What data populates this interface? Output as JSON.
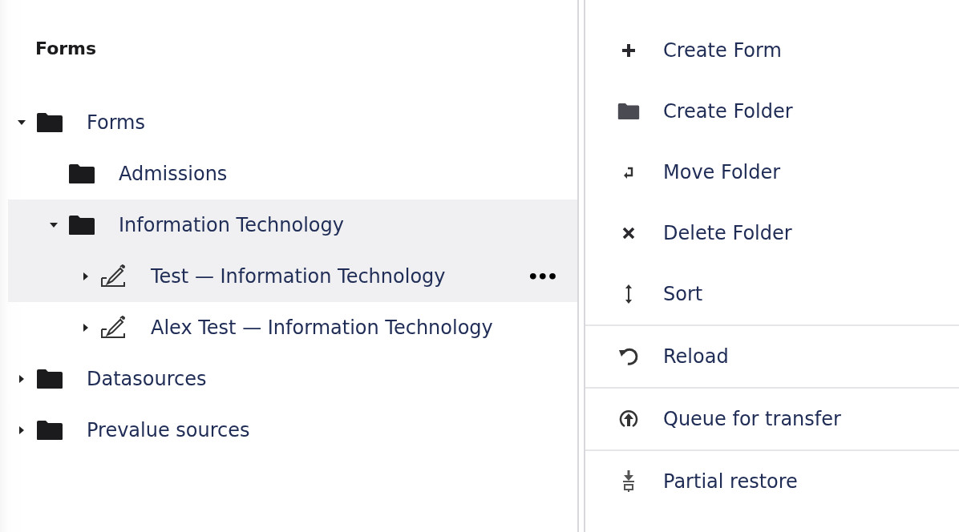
{
  "tree_panel": {
    "heading": "Forms",
    "items": [
      {
        "label": "Forms",
        "kind": "folder",
        "expanded": true,
        "selected": false,
        "children": [
          {
            "label": "Admissions",
            "kind": "folder",
            "selected": false
          },
          {
            "label": "Information Technology",
            "kind": "folder",
            "expanded": true,
            "selected": true,
            "children": [
              {
                "label": "Test — Information Technology",
                "kind": "form",
                "expanded": false,
                "selected": true,
                "actions": "•••"
              },
              {
                "label": "Alex Test — Information Technology",
                "kind": "form",
                "expanded": false,
                "selected": false
              }
            ]
          }
        ]
      },
      {
        "label": "Datasources",
        "kind": "folder",
        "expanded": false,
        "selected": false
      },
      {
        "label": "Prevalue sources",
        "kind": "folder",
        "expanded": false,
        "selected": false
      }
    ]
  },
  "actions_menu": {
    "groups": [
      {
        "items": [
          {
            "label": "Create Form",
            "kind": "plus"
          },
          {
            "label": "Create Folder",
            "kind": "folder"
          },
          {
            "label": "Move Folder",
            "kind": "move"
          },
          {
            "label": "Delete Folder",
            "kind": "delete"
          },
          {
            "label": "Sort",
            "kind": "sort"
          }
        ]
      },
      {
        "items": [
          {
            "label": "Reload",
            "kind": "reload"
          }
        ]
      },
      {
        "items": [
          {
            "label": "Queue for transfer",
            "kind": "upload"
          }
        ]
      },
      {
        "items": [
          {
            "label": "Partial restore",
            "kind": "restore"
          }
        ]
      }
    ]
  }
}
